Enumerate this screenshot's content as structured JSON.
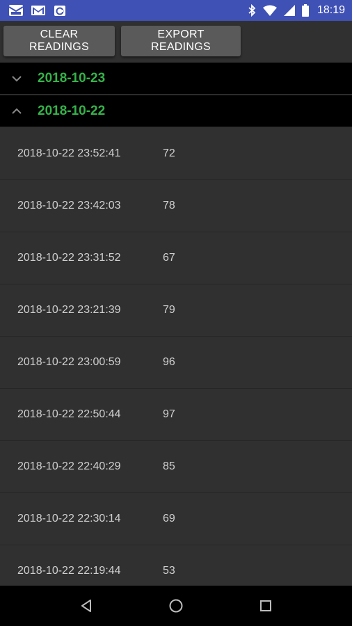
{
  "status_bar": {
    "time": "18:19",
    "left_icons": [
      "inbox-icon",
      "gmail-icon",
      "app-notification-icon"
    ],
    "right_icons": [
      "bluetooth-icon",
      "wifi-icon",
      "cell-signal-icon",
      "battery-icon"
    ]
  },
  "toolbar": {
    "clear_label": "CLEAR READINGS",
    "export_label": "EXPORT READINGS"
  },
  "groups": [
    {
      "date": "2018-10-23",
      "expanded": false
    },
    {
      "date": "2018-10-22",
      "expanded": true
    }
  ],
  "readings": [
    {
      "timestamp": "2018-10-22 23:52:41",
      "value": "72"
    },
    {
      "timestamp": "2018-10-22 23:42:03",
      "value": "78"
    },
    {
      "timestamp": "2018-10-22 23:31:52",
      "value": "67"
    },
    {
      "timestamp": "2018-10-22 23:21:39",
      "value": "79"
    },
    {
      "timestamp": "2018-10-22 23:00:59",
      "value": "96"
    },
    {
      "timestamp": "2018-10-22 22:50:44",
      "value": "97"
    },
    {
      "timestamp": "2018-10-22 22:40:29",
      "value": "85"
    },
    {
      "timestamp": "2018-10-22 22:30:14",
      "value": "69"
    },
    {
      "timestamp": "2018-10-22 22:19:44",
      "value": "53"
    }
  ],
  "nav_bar": {
    "icons": [
      "back-icon",
      "home-icon",
      "recents-icon"
    ]
  },
  "colors": {
    "status_bar": "#3f51b5",
    "date_green": "#35b34a",
    "background": "#303030",
    "button": "#5a5a5a"
  }
}
